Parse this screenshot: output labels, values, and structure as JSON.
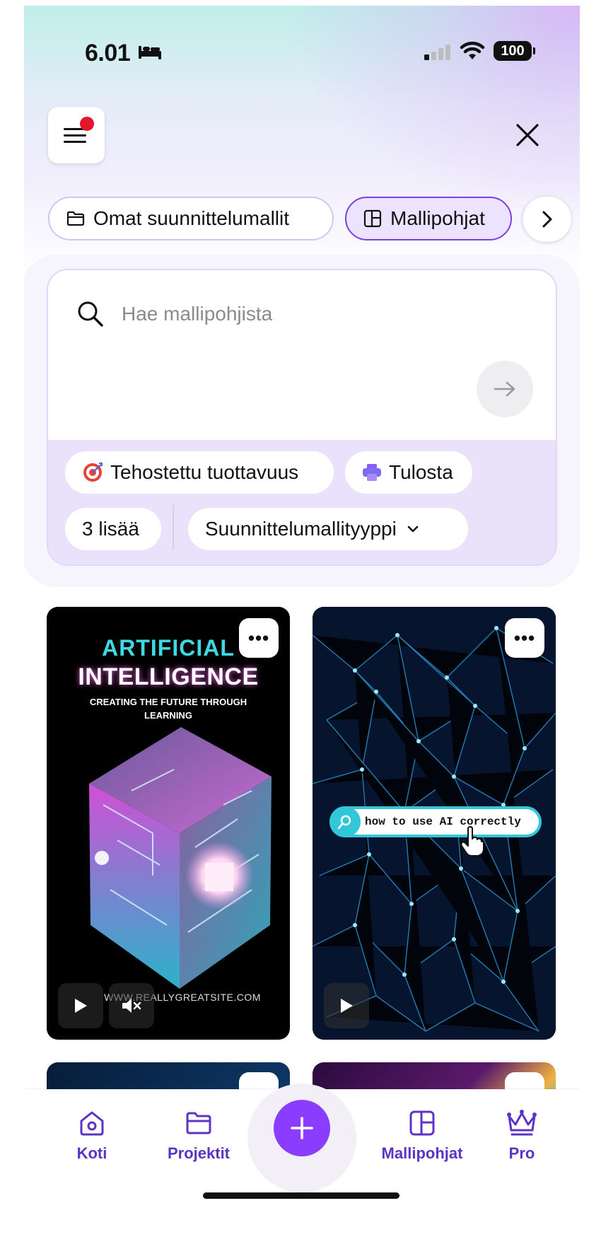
{
  "status_bar": {
    "time": "6.01",
    "battery": "100"
  },
  "tabs_row": {
    "items": [
      {
        "label": "Omat suunnittelumallit",
        "icon": "folder-icon"
      },
      {
        "label": "Mallipohjat",
        "icon": "template-icon",
        "active": true
      }
    ]
  },
  "search": {
    "placeholder": "Hae mallipohjista",
    "chips": [
      {
        "label": "Tehostettu tuottavuus",
        "icon": "target-icon"
      },
      {
        "label": "Tulosta",
        "icon": "printer-icon"
      },
      {
        "label": "3 lisää"
      },
      {
        "label": "Suunnittelumallityyppi",
        "icon": "chevron-down-icon"
      }
    ]
  },
  "cards": [
    {
      "title_line1": "ARTIFICIAL",
      "title_line2": "INTELLIGENCE",
      "subtitle": "CREATING THE FUTURE THROUGH LEARNING",
      "url": "WWW.REALLYGREATSITE.COM"
    },
    {
      "query": "how to use AI correctly"
    }
  ],
  "bottom_nav": {
    "items": [
      {
        "label": "Koti",
        "icon": "home-icon"
      },
      {
        "label": "Projektit",
        "icon": "folder-icon"
      },
      {
        "label": "Mallipohjat",
        "icon": "template-icon"
      },
      {
        "label": "Pro",
        "icon": "crown-icon"
      }
    ]
  },
  "colors": {
    "accent": "#8b3dff",
    "nav_text": "#5c33c7"
  }
}
